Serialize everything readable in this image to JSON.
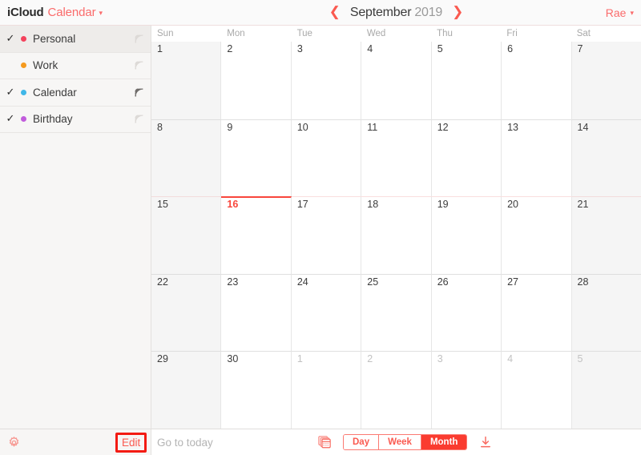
{
  "brand": {
    "icloud": "iCloud",
    "app": "Calendar",
    "chevron_icon": "chevron-down-icon"
  },
  "header": {
    "prev_icon": "chevron-left-icon",
    "next_icon": "chevron-right-icon",
    "month": "September",
    "year": "2019",
    "account_name": "Rae",
    "account_chevron_icon": "chevron-down-icon"
  },
  "sidebar": {
    "calendars": [
      {
        "name": "Personal",
        "color": "#f4425c",
        "checked": true,
        "check": "✓",
        "selected": true,
        "shared": false,
        "share_icon": "broadcast-icon"
      },
      {
        "name": "Work",
        "color": "#f59a1e",
        "checked": false,
        "check": "",
        "selected": false,
        "shared": false,
        "share_icon": "broadcast-icon"
      },
      {
        "name": "Calendar",
        "color": "#3fb7e8",
        "checked": true,
        "check": "✓",
        "selected": false,
        "shared": true,
        "share_icon": "broadcast-icon"
      },
      {
        "name": "Birthday",
        "color": "#c15cdc",
        "checked": true,
        "check": "✓",
        "selected": false,
        "shared": false,
        "share_icon": "broadcast-icon"
      }
    ]
  },
  "calendar": {
    "weekdays": [
      "Sun",
      "Mon",
      "Tue",
      "Wed",
      "Thu",
      "Fri",
      "Sat"
    ],
    "weekend_columns": [
      0,
      6
    ],
    "today": {
      "day": 16,
      "week": 2,
      "column": 1
    },
    "weeks": [
      [
        {
          "day": "1",
          "other": false
        },
        {
          "day": "2",
          "other": false
        },
        {
          "day": "3",
          "other": false
        },
        {
          "day": "4",
          "other": false
        },
        {
          "day": "5",
          "other": false
        },
        {
          "day": "6",
          "other": false
        },
        {
          "day": "7",
          "other": false
        }
      ],
      [
        {
          "day": "8",
          "other": false
        },
        {
          "day": "9",
          "other": false
        },
        {
          "day": "10",
          "other": false
        },
        {
          "day": "11",
          "other": false
        },
        {
          "day": "12",
          "other": false
        },
        {
          "day": "13",
          "other": false
        },
        {
          "day": "14",
          "other": false
        }
      ],
      [
        {
          "day": "15",
          "other": false
        },
        {
          "day": "16",
          "other": false,
          "today": true
        },
        {
          "day": "17",
          "other": false
        },
        {
          "day": "18",
          "other": false
        },
        {
          "day": "19",
          "other": false
        },
        {
          "day": "20",
          "other": false
        },
        {
          "day": "21",
          "other": false
        }
      ],
      [
        {
          "day": "22",
          "other": false
        },
        {
          "day": "23",
          "other": false
        },
        {
          "day": "24",
          "other": false
        },
        {
          "day": "25",
          "other": false
        },
        {
          "day": "26",
          "other": false
        },
        {
          "day": "27",
          "other": false
        },
        {
          "day": "28",
          "other": false
        }
      ],
      [
        {
          "day": "29",
          "other": false
        },
        {
          "day": "30",
          "other": false
        },
        {
          "day": "1",
          "other": true
        },
        {
          "day": "2",
          "other": true
        },
        {
          "day": "3",
          "other": true
        },
        {
          "day": "4",
          "other": true
        },
        {
          "day": "5",
          "other": true
        }
      ]
    ]
  },
  "bottombar": {
    "settings_icon": "gear-icon",
    "edit_label": "Edit",
    "goto_today_label": "Go to today",
    "calendars_stack_icon": "calendar-stack-icon",
    "views": [
      {
        "label": "Day",
        "active": false
      },
      {
        "label": "Week",
        "active": false
      },
      {
        "label": "Month",
        "active": true
      }
    ],
    "download_icon": "download-icon"
  },
  "colors": {
    "accent": "#fa5a50",
    "today": "#f8463c",
    "annotation_box": "#f31b13",
    "weekend_bg": "#f5f5f5",
    "sidebar_bg": "#f7f6f5"
  }
}
